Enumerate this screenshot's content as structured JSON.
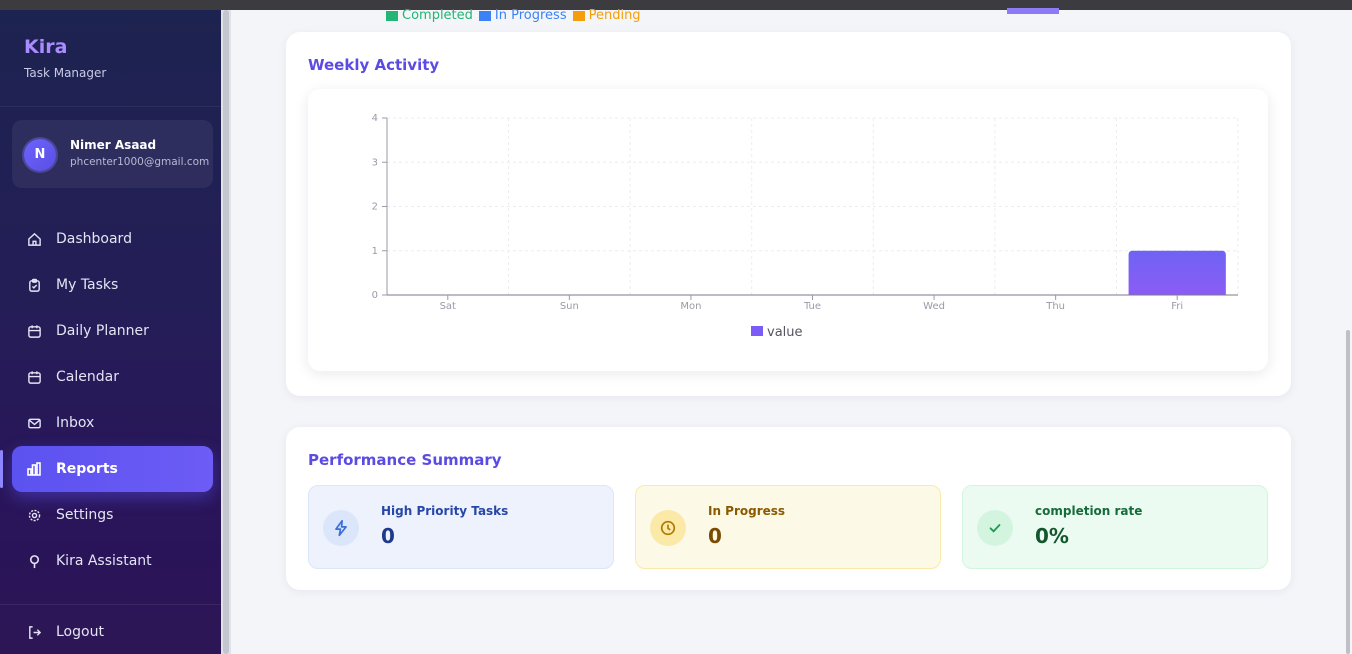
{
  "app": {
    "name": "Kira",
    "subtitle": "Task Manager"
  },
  "user": {
    "initial": "N",
    "name": "Nimer Asaad",
    "email": "phcenter1000@gmail.com"
  },
  "nav": [
    {
      "label": "Dashboard",
      "icon": "home-icon",
      "active": false
    },
    {
      "label": "My Tasks",
      "icon": "clipboard-check-icon",
      "active": false
    },
    {
      "label": "Daily Planner",
      "icon": "calendar-icon",
      "active": false
    },
    {
      "label": "Calendar",
      "icon": "calendar-icon",
      "active": false
    },
    {
      "label": "Inbox",
      "icon": "mail-icon",
      "active": false
    },
    {
      "label": "Reports",
      "icon": "bar-chart-icon",
      "active": true
    },
    {
      "label": "Settings",
      "icon": "gear-icon",
      "active": false
    },
    {
      "label": "Kira Assistant",
      "icon": "lightbulb-icon",
      "active": false
    }
  ],
  "logout": {
    "label": "Logout",
    "icon": "logout-icon"
  },
  "top_legend": [
    {
      "label": "Completed",
      "color": "#22b573"
    },
    {
      "label": "In Progress",
      "color": "#3b82f6"
    },
    {
      "label": "Pending",
      "color": "#f59e0b"
    }
  ],
  "weekly": {
    "title": "Weekly Activity",
    "chart_data": {
      "type": "bar",
      "categories": [
        "Sat",
        "Sun",
        "Mon",
        "Tue",
        "Wed",
        "Thu",
        "Fri"
      ],
      "series": [
        {
          "name": "value",
          "values": [
            0,
            0,
            0,
            0,
            0,
            0,
            1
          ],
          "color": "#7c5cf6"
        }
      ],
      "ylim": [
        0,
        4
      ],
      "yticks": [
        0,
        1,
        2,
        3,
        4
      ],
      "grid": true,
      "legend": "bottom-center"
    }
  },
  "performance": {
    "title": "Performance Summary",
    "items": [
      {
        "label": "High Priority Tasks",
        "value": "0",
        "icon": "lightning-icon",
        "bg": "#edf2fd",
        "icon_bg": "#dbe6fb",
        "icon_color": "#3b6fd8",
        "label_color": "#2747a8",
        "value_color": "#1e3a8a"
      },
      {
        "label": "In Progress",
        "value": "0",
        "icon": "clock-icon",
        "bg": "#fdf9e7",
        "icon_bg": "#fbe9a8",
        "icon_color": "#b07a00",
        "label_color": "#8a5a00",
        "value_color": "#7a4b00"
      },
      {
        "label": "completion rate",
        "value": "0%",
        "icon": "check-icon",
        "bg": "#ecfbf1",
        "icon_bg": "#d3f5df",
        "icon_color": "#1f9a52",
        "label_color": "#166b3a",
        "value_color": "#14572f"
      }
    ]
  }
}
